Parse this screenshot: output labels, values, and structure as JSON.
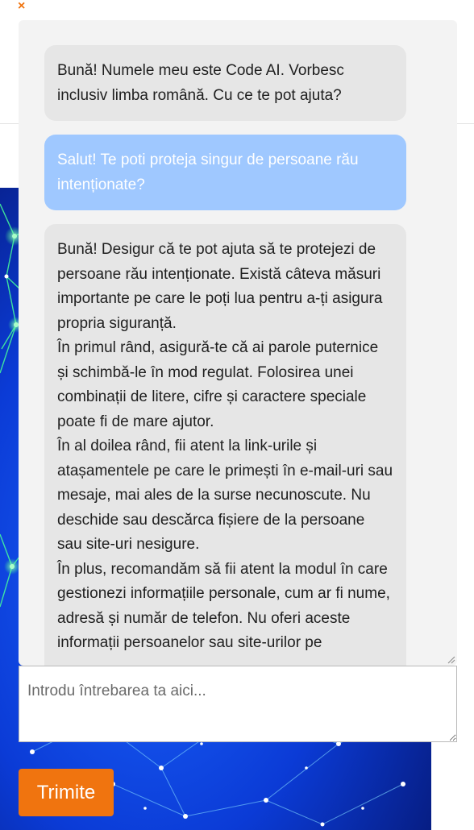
{
  "close_icon_glyph": "×",
  "accent_color": "#f0740f",
  "chat": {
    "messages": [
      {
        "role": "bot",
        "text": "Bună! Numele meu este Code AI. Vorbesc inclusiv limba română. Cu ce te pot ajuta?"
      },
      {
        "role": "user",
        "text": "Salut! Te poti proteja singur de persoane rău intenționate?"
      },
      {
        "role": "bot",
        "text": "Bună! Desigur că te pot ajuta să te protejezi de persoane rău intenționate. Există câteva măsuri importante pe care le poți lua pentru a-ți asigura propria siguranță.\nÎn primul rând, asigură-te că ai parole puternice și schimbă-le în mod regulat. Folosirea unei combinații de litere, cifre și caractere speciale poate fi de mare ajutor.\nÎn al doilea rând, fii atent la link-urile și atașamentele pe care le primești în e-mail-uri sau mesaje, mai ales de la surse necunoscute. Nu deschide sau descărca fișiere de la persoane sau site-uri nesigure.\nÎn plus, recomandăm să fii atent la modul în care gestionezi informațiile personale, cum ar fi nume, adresă și număr de telefon. Nu oferi aceste informații persoanelor sau site-urilor pe"
      }
    ],
    "bot_bubble_color": "#e6e6e6",
    "user_bubble_color": "#9fc8ff"
  },
  "input": {
    "placeholder": "Introdu întrebarea ta aici...",
    "value": ""
  },
  "send_button_label": "Trimite"
}
